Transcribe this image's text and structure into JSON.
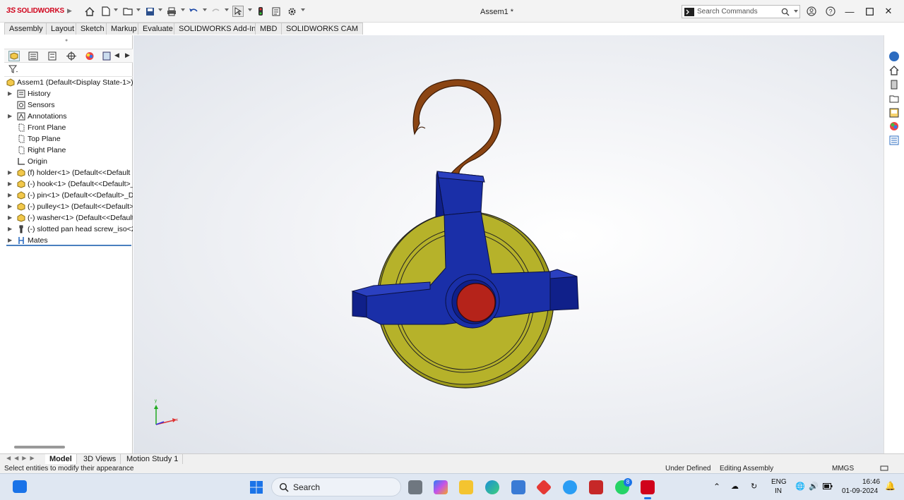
{
  "app": {
    "logo": "SOLIDWORKS",
    "logo_prefix": "3S",
    "doc_title": "Assem1 *"
  },
  "search": {
    "placeholder": "Search Commands"
  },
  "command_tabs": [
    "Assembly",
    "Layout",
    "Sketch",
    "Markup",
    "Evaluate",
    "SOLIDWORKS Add-Ins",
    "MBD",
    "SOLIDWORKS CAM"
  ],
  "tree": {
    "root": "Assem1  (Default<Display State-1>)",
    "items": [
      {
        "label": "History",
        "expandable": true,
        "icon": "history-icon"
      },
      {
        "label": "Sensors",
        "expandable": false,
        "icon": "sensors-icon"
      },
      {
        "label": "Annotations",
        "expandable": true,
        "icon": "annotations-icon"
      },
      {
        "label": "Front Plane",
        "expandable": false,
        "icon": "plane-icon"
      },
      {
        "label": "Top Plane",
        "expandable": false,
        "icon": "plane-icon"
      },
      {
        "label": "Right Plane",
        "expandable": false,
        "icon": "plane-icon"
      },
      {
        "label": "Origin",
        "expandable": false,
        "icon": "origin-icon"
      },
      {
        "label": "(f) holder<1> (Default<<Default",
        "expandable": true,
        "icon": "part-icon"
      },
      {
        "label": "(-) hook<1> (Default<<Default>_",
        "expandable": true,
        "icon": "part-icon"
      },
      {
        "label": "(-) pin<1> (Default<<Default>_D",
        "expandable": true,
        "icon": "part-icon"
      },
      {
        "label": "(-) pulley<1> (Default<<Default>",
        "expandable": true,
        "icon": "part-icon"
      },
      {
        "label": "(-) washer<1> (Default<<Default",
        "expandable": true,
        "icon": "part-icon"
      },
      {
        "label": "(-) slotted pan head screw_iso<2>",
        "expandable": true,
        "icon": "toolbox-icon"
      },
      {
        "label": "Mates",
        "expandable": true,
        "icon": "mates-icon"
      }
    ]
  },
  "bottom_tabs": [
    "Model",
    "3D Views",
    "Motion Study 1"
  ],
  "status": {
    "message": "Select entities to modify their appearance",
    "definition": "Under Defined",
    "mode": "Editing Assembly",
    "units": "MMGS"
  },
  "taskbar": {
    "search_label": "Search",
    "lang": "ENG",
    "region": "IN",
    "time": "16:46",
    "date": "01-09-2024",
    "whatsapp_badge": "8"
  },
  "colors": {
    "holder": "#1a2fa8",
    "pulley": "#b6b22a",
    "hook": "#8b4513",
    "pin": "#b5231a",
    "accent": "#d0021b"
  }
}
